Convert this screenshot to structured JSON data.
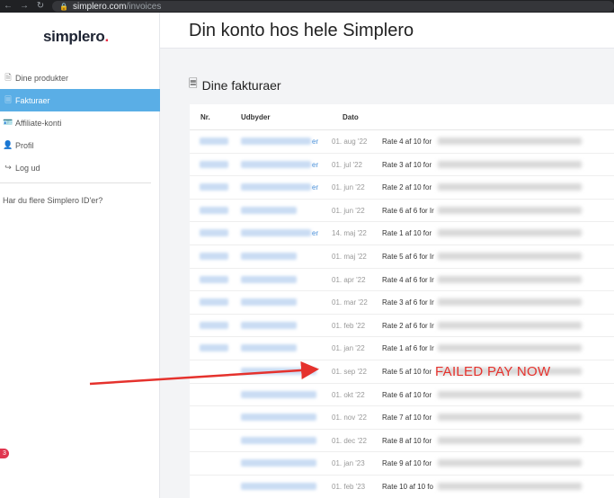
{
  "browser": {
    "url_host": "simplero.com",
    "url_path": "/invoices"
  },
  "sidebar": {
    "logo_text": "simplero",
    "logo_dot": ".",
    "items": [
      {
        "label": "Dine produkter",
        "icon": "file-icon",
        "glyph": "🗎"
      },
      {
        "label": "Fakturaer",
        "icon": "invoice-icon",
        "glyph": "🗏"
      },
      {
        "label": "Affiliate-konti",
        "icon": "id-card-icon",
        "glyph": "🪪"
      },
      {
        "label": "Profil",
        "icon": "user-icon",
        "glyph": "👤"
      },
      {
        "label": "Log ud",
        "icon": "logout-icon",
        "glyph": "↪"
      }
    ],
    "active_index": 1,
    "question": "Har du flere Simplero ID'er?",
    "badge": "3"
  },
  "page_title": "Din konto hos hele Simplero",
  "invoices": {
    "title": "Dine fakturaer",
    "columns": {
      "nr": "Nr.",
      "provider": "Udbyder",
      "date": "Dato"
    },
    "rows": [
      {
        "date": "01. aug '22",
        "rate": "Rate 4 af 10 for",
        "suffix": "er"
      },
      {
        "date": "01. jul '22",
        "rate": "Rate 3 af 10 for",
        "suffix": "er"
      },
      {
        "date": "01. jun '22",
        "rate": "Rate 2 af 10 for",
        "suffix": "er"
      },
      {
        "date": "01. jun '22",
        "rate": "Rate 6 af 6 for Ir",
        "suffix": ""
      },
      {
        "date": "14. maj '22",
        "rate": "Rate 1 af 10 for",
        "suffix": "er"
      },
      {
        "date": "01. maj '22",
        "rate": "Rate 5 af 6 for Ir",
        "suffix": ""
      },
      {
        "date": "01. apr '22",
        "rate": "Rate 4 af 6 for Ir",
        "suffix": ""
      },
      {
        "date": "01. mar '22",
        "rate": "Rate 3 af 6 for Ir",
        "suffix": ""
      },
      {
        "date": "01. feb '22",
        "rate": "Rate 2 af 6 for Ir",
        "suffix": ""
      },
      {
        "date": "01. jan '22",
        "rate": "Rate 1 af 6 for Ir",
        "suffix": ""
      },
      {
        "date": "01. sep '22",
        "rate": "Rate 5 af 10 for",
        "suffix": ""
      },
      {
        "date": "01. okt '22",
        "rate": "Rate 6 af 10 for",
        "suffix": ""
      },
      {
        "date": "01. nov '22",
        "rate": "Rate 7 af 10 for",
        "suffix": ""
      },
      {
        "date": "01. dec '22",
        "rate": "Rate 8 af 10 for",
        "suffix": ""
      },
      {
        "date": "01. jan '23",
        "rate": "Rate 9 af 10 for",
        "suffix": ""
      },
      {
        "date": "01. feb '23",
        "rate": "Rate 10 af 10 fo",
        "suffix": ""
      }
    ]
  },
  "annotation": {
    "text": "FAILED PAY NOW",
    "color": "#e5322d"
  },
  "colors": {
    "accent": "#5aaee6",
    "link": "#4a90d9",
    "badge": "#e0364f"
  }
}
